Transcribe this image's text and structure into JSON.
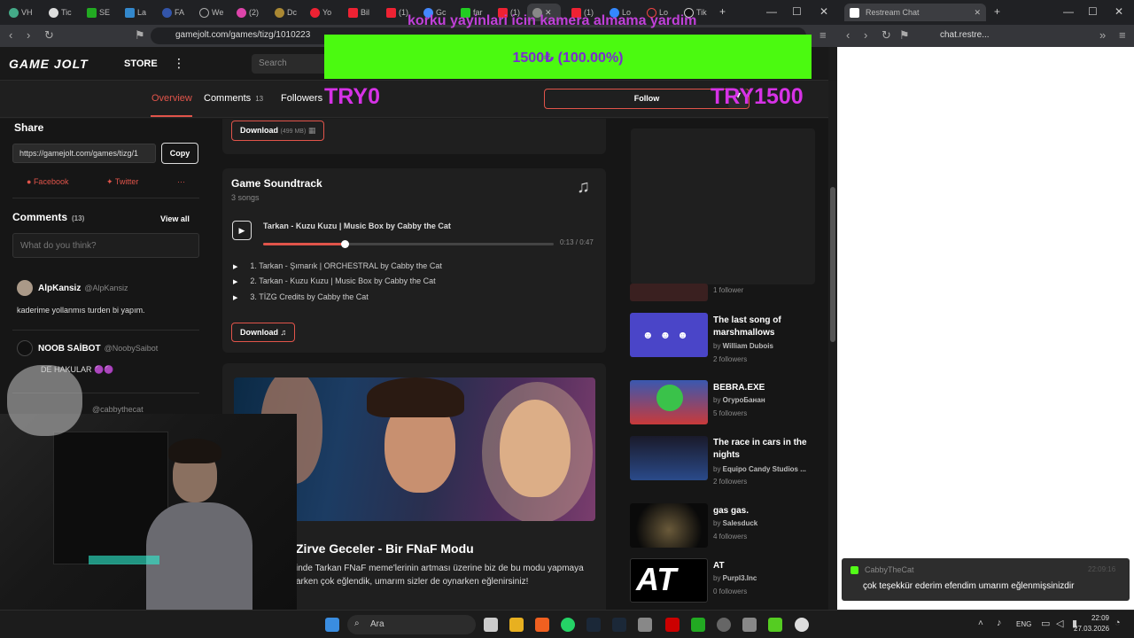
{
  "browser": {
    "tabs": [
      "VH",
      "Tic",
      "SE",
      "La",
      "FA",
      "We",
      "(2)",
      "Dc",
      "Yo",
      "Bil",
      "(1)",
      "Gc",
      "far",
      "(1)",
      "",
      "(1)",
      "Lo",
      "Lo",
      "Tik"
    ],
    "url": "gamejolt.com/games/tizg/1010223",
    "right_tab_title": "Restream Chat",
    "right_url": "chat.restre..."
  },
  "header": {
    "logo": "GAME JOLT",
    "store": "STORE",
    "more": "⋮",
    "search_placeholder": "Search"
  },
  "gamenav": {
    "overview": "Overview",
    "comments": "Comments",
    "comments_count": "13",
    "followers": "Followers",
    "follow": "Follow"
  },
  "share": {
    "title": "Share",
    "url": "https://gamejolt.com/games/tizg/1",
    "copy": "Copy",
    "facebook": "Facebook",
    "twitter": "Twitter",
    "more": "···"
  },
  "comments": {
    "title": "Comments",
    "count": "(13)",
    "view_all": "View all",
    "placeholder": "What do you think?",
    "items": [
      {
        "name": "AlpKansiz",
        "handle": "@AlpKansiz",
        "text": "kaderime yollanmıs turden bi yapım."
      },
      {
        "name": "NOOB SAİBOT",
        "handle": "@NoobySaibot",
        "text": "DE HAKULAR 🟣🟣"
      },
      {
        "name": "",
        "handle": "@cabbythecat",
        "text": ""
      }
    ]
  },
  "download_top": {
    "label": "Download",
    "size": "(499 MB)"
  },
  "soundtrack": {
    "title": "Game Soundtrack",
    "count": "3 songs",
    "now_playing": "Tarkan - Kuzu Kuzu | Music Box by Cabby the Cat",
    "time": "0:13 / 0:47",
    "progress": 0.28,
    "tracks": [
      {
        "num": "1.",
        "name": "Tarkan - Şımarık | ORCHESTRAL by Cabby the Cat"
      },
      {
        "num": "2.",
        "name": "Tarkan - Kuzu Kuzu | Music Box by Cabby the Cat"
      },
      {
        "num": "3.",
        "name": "TİZG Credits by Cabby the Cat"
      }
    ],
    "download": "Download ♫"
  },
  "article": {
    "title": "Zirve Geceler - Bir FNaF Modu",
    "line1": "inde Tarkan FNaF meme'lerinin artması üzerine biz de bu modu yapmaya",
    "line2": "arken çok eğlendik, umarım sizler de oynarken eğlenirsiniz!"
  },
  "recommended": [
    {
      "title": "",
      "by": "",
      "followers": "1 follower"
    },
    {
      "title": "The last song of marshmallows",
      "by": "William Dubois",
      "followers": "2 followers"
    },
    {
      "title": "BEBRA.EXE",
      "by": "ОгуроБанан",
      "followers": "5 followers"
    },
    {
      "title": "The race in cars in the nights",
      "by": "Equipo Candy Studios ...",
      "followers": "2 followers"
    },
    {
      "title": "gas gas.",
      "by": "Salesduck",
      "followers": "4 followers"
    },
    {
      "title": "AT",
      "by": "Purpl3.Inc",
      "followers": "0 followers"
    }
  ],
  "overlay": {
    "donation_title": "korku yayinlari icin kamera almama yardim",
    "donation_progress": "1500₺ (100.00%)",
    "try_start": "TRY0",
    "try_goal": "TRY1500"
  },
  "chat": {
    "user": "CabbyTheCat",
    "time": "22:09:16",
    "message": "çok teşekkür ederim efendim umarım eğlenmişsinizdir"
  },
  "taskbar": {
    "search": "Ara",
    "lang": "ENG",
    "time": "22:09",
    "date": "27.03.2026"
  },
  "colors": {
    "accent": "#e1544a",
    "donation_bg": "#4bfa10",
    "overlay_text": "#d632e6"
  }
}
